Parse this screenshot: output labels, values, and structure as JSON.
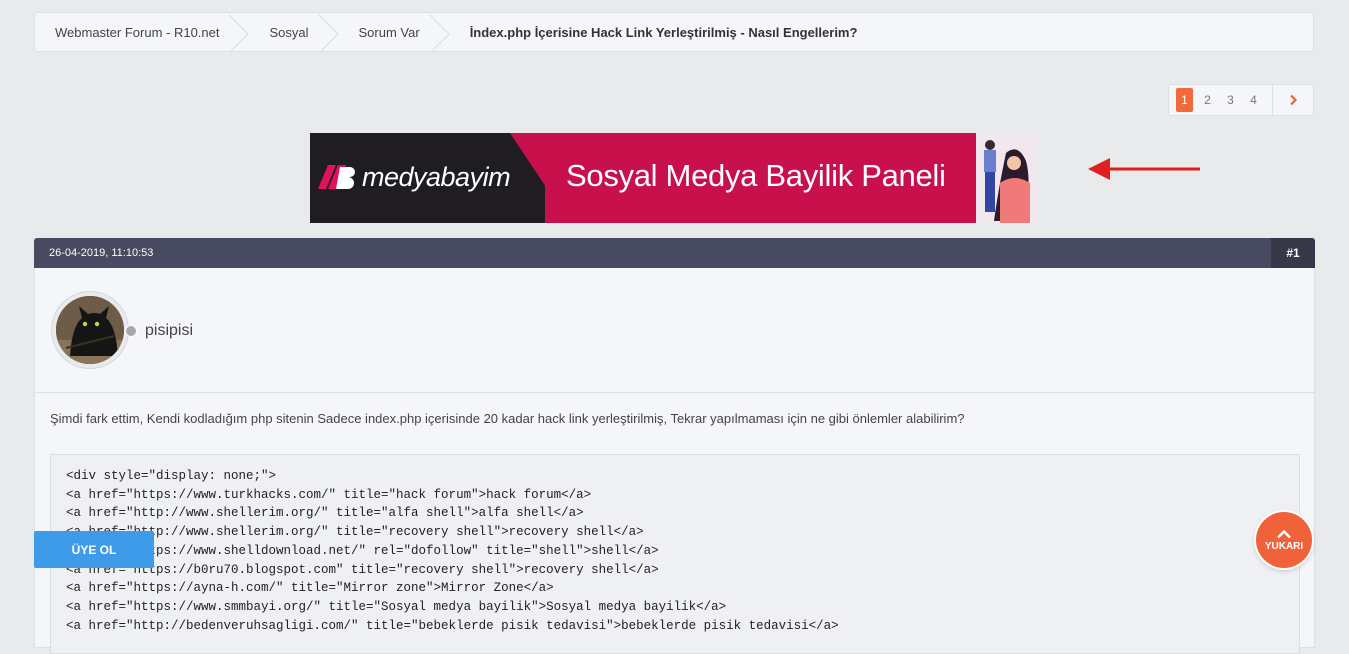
{
  "breadcrumb": [
    "Webmaster Forum - R10.net",
    "Sosyal",
    "Sorum Var",
    "İndex.php İçerisine Hack Link Yerleştirilmiş - Nasıl Engellerim?"
  ],
  "pagination": {
    "pages": [
      "1",
      "2",
      "3",
      "4"
    ],
    "current": "1",
    "next_icon": "chevron-right-icon"
  },
  "ad": {
    "brand": "medyabayim",
    "logo_mark": "MB",
    "headline": "Sosyal Medya Bayilik Paneli"
  },
  "post": {
    "date": "26-04-2019, 11:10:53",
    "number": "#1",
    "author": "pisipisi",
    "message": "Şimdi fark ettim, Kendi kodladığım php sitenin Sadece index.php içerisinde 20 kadar hack link yerleştirilmiş, Tekrar yapılmaması için ne gibi önlemler alabilirim?",
    "code_lines": [
      "<div style=\"display: none;\">",
      "<a href=\"https://www.turkhacks.com/\" title=\"hack forum\">hack forum</a>",
      "<a href=\"http://www.shellerim.org/\" title=\"alfa shell\">alfa shell</a>",
      "<a href=\"http://www.shellerim.org/\" title=\"recovery shell\">recovery shell</a>",
      "<a href=\"https://www.shelldownload.net/\" rel=\"dofollow\" title=\"shell\">shell</a>",
      "<a href=\"https://b0ru70.blogspot.com\" title=\"recovery shell\">recovery shell</a>",
      "<a href=\"https://ayna-h.com/\" title=\"Mirror zone\">Mirror Zone</a>",
      "<a href=\"https://www.smmbayi.org/\" title=\"Sosyal medya bayilik\">Sosyal medya bayilik</a>",
      "<a href=\"http://bedenveruhsagligi.com/\" title=\"bebeklerde pisik tedavisi\">bebeklerde pisik tedavisi</a>"
    ]
  },
  "buttons": {
    "signup": "ÜYE OL",
    "top": "YUKARI"
  },
  "colors": {
    "accent": "#f26a3b",
    "header": "#474a60",
    "signup": "#3d9be9",
    "arrow": "#e01f1f"
  }
}
